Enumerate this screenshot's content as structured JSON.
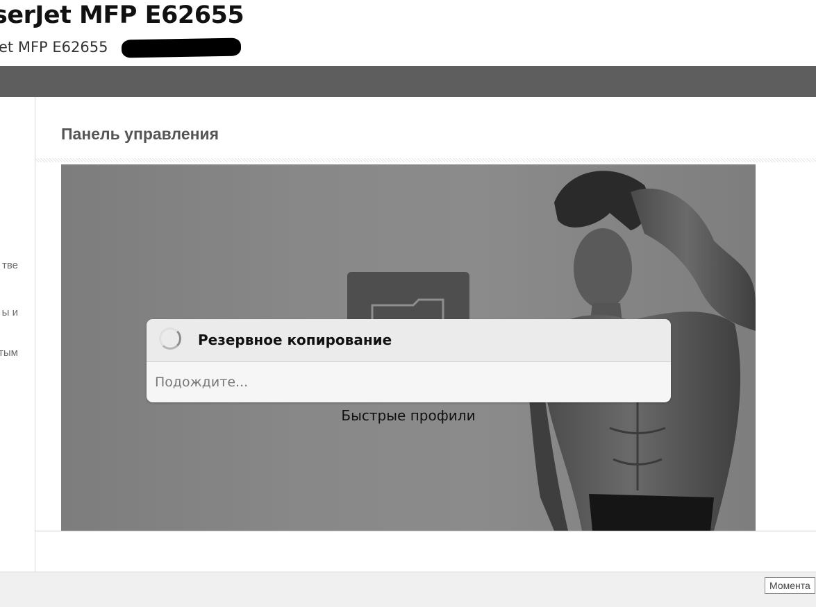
{
  "header": {
    "title": "serJet MFP E62655",
    "subtitle": "et MFP E62655"
  },
  "sidebar": {
    "items": [
      {
        "label": "тве"
      },
      {
        "label": "ы и"
      },
      {
        "label": "тым"
      }
    ]
  },
  "main": {
    "page_title": "Панель управления",
    "control_panel": {
      "tile_label": "Быстрые профили",
      "tile_icon": "folder-icon",
      "dialog": {
        "title": "Резервное копирование",
        "message": "Подождите...",
        "icon": "spinner-icon"
      }
    }
  },
  "footer": {
    "button_label": "Момента"
  },
  "colors": {
    "navbar": "#5e5e5e",
    "dialog_header": "#ebebeb",
    "dialog_body": "#f6f6f6",
    "footer": "#f0f0f0"
  }
}
